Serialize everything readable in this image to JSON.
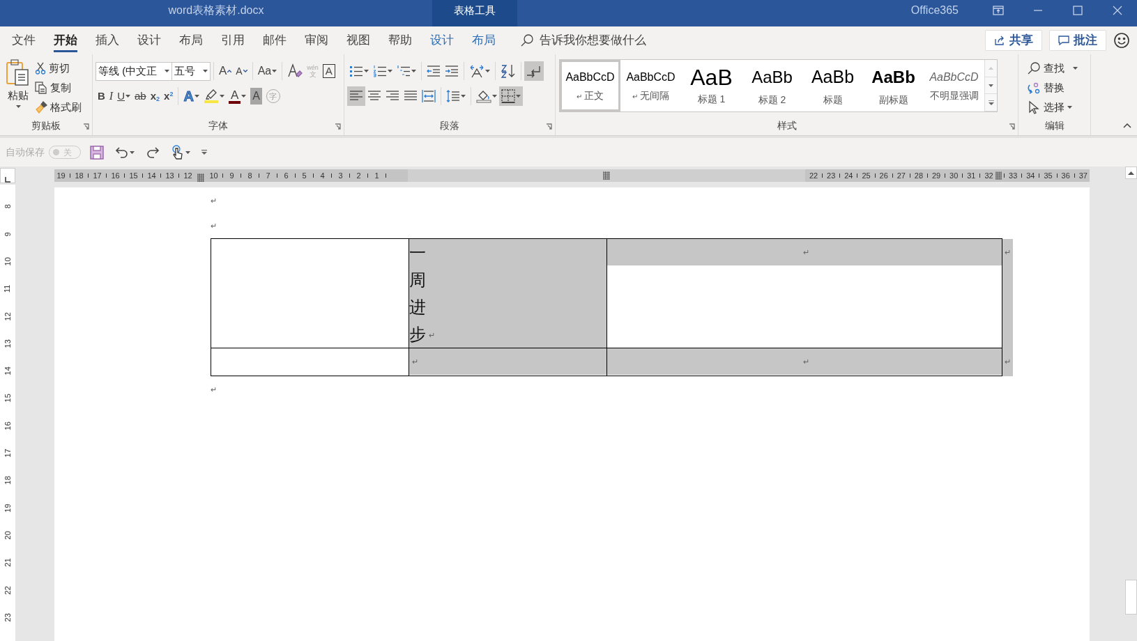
{
  "window": {
    "title": "word表格素材.docx",
    "context_tab": "表格工具",
    "account": "Office365"
  },
  "tabs": [
    {
      "label": "文件",
      "kind": "main",
      "selected": false
    },
    {
      "label": "开始",
      "kind": "main",
      "selected": true
    },
    {
      "label": "插入",
      "kind": "main",
      "selected": false
    },
    {
      "label": "设计",
      "kind": "main",
      "selected": false
    },
    {
      "label": "布局",
      "kind": "main",
      "selected": false
    },
    {
      "label": "引用",
      "kind": "main",
      "selected": false
    },
    {
      "label": "邮件",
      "kind": "main",
      "selected": false
    },
    {
      "label": "审阅",
      "kind": "main",
      "selected": false
    },
    {
      "label": "视图",
      "kind": "main",
      "selected": false
    },
    {
      "label": "帮助",
      "kind": "main",
      "selected": false
    },
    {
      "label": "设计",
      "kind": "context",
      "selected": false
    },
    {
      "label": "布局",
      "kind": "context",
      "selected": false
    }
  ],
  "search": {
    "placeholder": "告诉我你想要做什么"
  },
  "share_button": "共享",
  "comment_button": "批注",
  "clipboard": {
    "label": "剪贴板",
    "paste": "粘贴",
    "cut": "剪切",
    "copy": "复制",
    "format_painter": "格式刷"
  },
  "font": {
    "label": "字体",
    "family": "等线 (中文正",
    "size": "五号",
    "row1": [
      [
        {
          "kind": "grow",
          "label": "A",
          "dropdown": false,
          "selected": false
        },
        {
          "kind": "shrink",
          "label": "A",
          "dropdown": false,
          "selected": false
        }
      ],
      [
        {
          "kind": "case",
          "label": "Aa",
          "dropdown": true,
          "selected": false
        }
      ],
      [
        {
          "kind": "clear",
          "dropdown": false,
          "selected": false
        },
        {
          "kind": "phonetic",
          "label": "wén",
          "lower": "文",
          "dropdown": false,
          "selected": false
        },
        {
          "kind": "border",
          "label": "A",
          "dropdown": false,
          "selected": false
        }
      ]
    ],
    "row2": [
      [
        {
          "kind": "bold",
          "label": "B",
          "dropdown": false,
          "selected": false
        },
        {
          "kind": "italic",
          "label": "I",
          "dropdown": false,
          "selected": false
        },
        {
          "kind": "underline",
          "label": "U",
          "dropdown": true,
          "selected": false
        },
        {
          "kind": "strike",
          "label": "ab",
          "dropdown": false,
          "selected": false
        },
        {
          "kind": "sub",
          "label": "x",
          "script": "2",
          "dropdown": false,
          "selected": false
        },
        {
          "kind": "sup",
          "label": "x",
          "script": "2",
          "dropdown": false,
          "selected": false
        }
      ],
      [
        {
          "kind": "effects",
          "label": "A",
          "dropdown": true,
          "selected": false
        },
        {
          "kind": "highlight",
          "dropdown": true,
          "selected": false
        },
        {
          "kind": "color",
          "label": "A",
          "dropdown": true,
          "selected": false
        },
        {
          "kind": "shading",
          "label": "A",
          "dropdown": false,
          "selected": false
        },
        {
          "kind": "enclose",
          "label": "字",
          "dropdown": false,
          "selected": false
        }
      ]
    ]
  },
  "paragraph": {
    "label": "段落",
    "row1": [
      [
        {
          "kind": "bullets",
          "dropdown": true,
          "selected": false
        },
        {
          "kind": "numbering",
          "dropdown": true,
          "selected": false
        },
        {
          "kind": "multilevel",
          "dropdown": true,
          "selected": false
        }
      ],
      [
        {
          "kind": "outdent",
          "dropdown": false,
          "selected": false
        },
        {
          "kind": "indent",
          "dropdown": false,
          "selected": false
        }
      ],
      [
        {
          "kind": "asian",
          "dropdown": true,
          "selected": false
        }
      ],
      [
        {
          "kind": "sort",
          "dropdown": false,
          "selected": false
        }
      ],
      [
        {
          "kind": "marks",
          "dropdown": false,
          "selected": true
        }
      ]
    ],
    "row2": [
      [
        {
          "kind": "left",
          "dropdown": false,
          "selected": true
        },
        {
          "kind": "center",
          "dropdown": false,
          "selected": false
        },
        {
          "kind": "right",
          "dropdown": false,
          "selected": false
        },
        {
          "kind": "justify",
          "dropdown": false,
          "selected": false
        },
        {
          "kind": "distributed",
          "dropdown": false,
          "selected": false
        }
      ],
      [
        {
          "kind": "spacing",
          "dropdown": true,
          "selected": false
        }
      ],
      [
        {
          "kind": "fill",
          "dropdown": true,
          "selected": false
        },
        {
          "kind": "borders",
          "dropdown": true,
          "selected": true
        }
      ]
    ]
  },
  "styles": {
    "label": "样式",
    "items": [
      {
        "sample": "AaBbCcD",
        "name": "正文",
        "mark": "↵",
        "kind": "body",
        "selected": true
      },
      {
        "sample": "AaBbCcD",
        "name": "无间隔",
        "mark": "↵",
        "kind": "body",
        "selected": false
      },
      {
        "sample": "AaB",
        "name": "标题 1",
        "kind": "heading1",
        "selected": false
      },
      {
        "sample": "AaBb",
        "name": "标题 2",
        "kind": "heading2",
        "selected": false
      },
      {
        "sample": "AaBb",
        "name": "标题",
        "kind": "title",
        "selected": false
      },
      {
        "sample": "AaBb",
        "name": "副标题",
        "kind": "subtitle",
        "selected": false
      },
      {
        "sample": "AaBbCcD",
        "name": "不明显强调",
        "kind": "emphasis",
        "selected": false
      }
    ]
  },
  "editing": {
    "label": "编辑",
    "find": "查找",
    "replace": "替换",
    "select": "选择"
  },
  "quick_access": {
    "autosave": "自动保存",
    "autosave_on": false,
    "autosave_state": "关"
  },
  "ruler": {
    "left_before_marker": [
      "19",
      "18",
      "17",
      "16",
      "15",
      "14",
      "13",
      "12"
    ],
    "left_after_marker": [
      "10",
      "9",
      "8",
      "7",
      "6",
      "5",
      "4",
      "3",
      "2",
      "1"
    ],
    "right_before_marker": [
      "22",
      "23",
      "24",
      "25",
      "26",
      "27",
      "28",
      "29",
      "30",
      "31",
      "32"
    ],
    "right_after_marker": [
      "33",
      "34",
      "35",
      "36",
      "37"
    ]
  },
  "vertical_ruler": [
    "8",
    "9",
    "10",
    "11",
    "12",
    "13",
    "14",
    "15",
    "16",
    "17",
    "18",
    "19",
    "20",
    "21",
    "22",
    "23"
  ],
  "document": {
    "paragraphs_before": [
      "↵",
      "↵"
    ],
    "table": {
      "rows": [
        {
          "cells": [
            {
              "selected": false
            },
            {
              "text": "一周进步",
              "kind": "vertical",
              "mark": "↵",
              "centered": false,
              "selected": true
            },
            {
              "mark": "↵",
              "centered": true,
              "selected": true
            }
          ],
          "end_mark": "↵",
          "end_selected": true
        },
        {
          "cells": [
            {
              "selected": false
            },
            {
              "mark": "↵",
              "centered": false,
              "selected": true
            },
            {
              "mark": "↵",
              "centered": true,
              "selected": true
            }
          ],
          "end_mark": "↵",
          "end_selected": true
        }
      ]
    },
    "paragraph_after": "↵"
  }
}
